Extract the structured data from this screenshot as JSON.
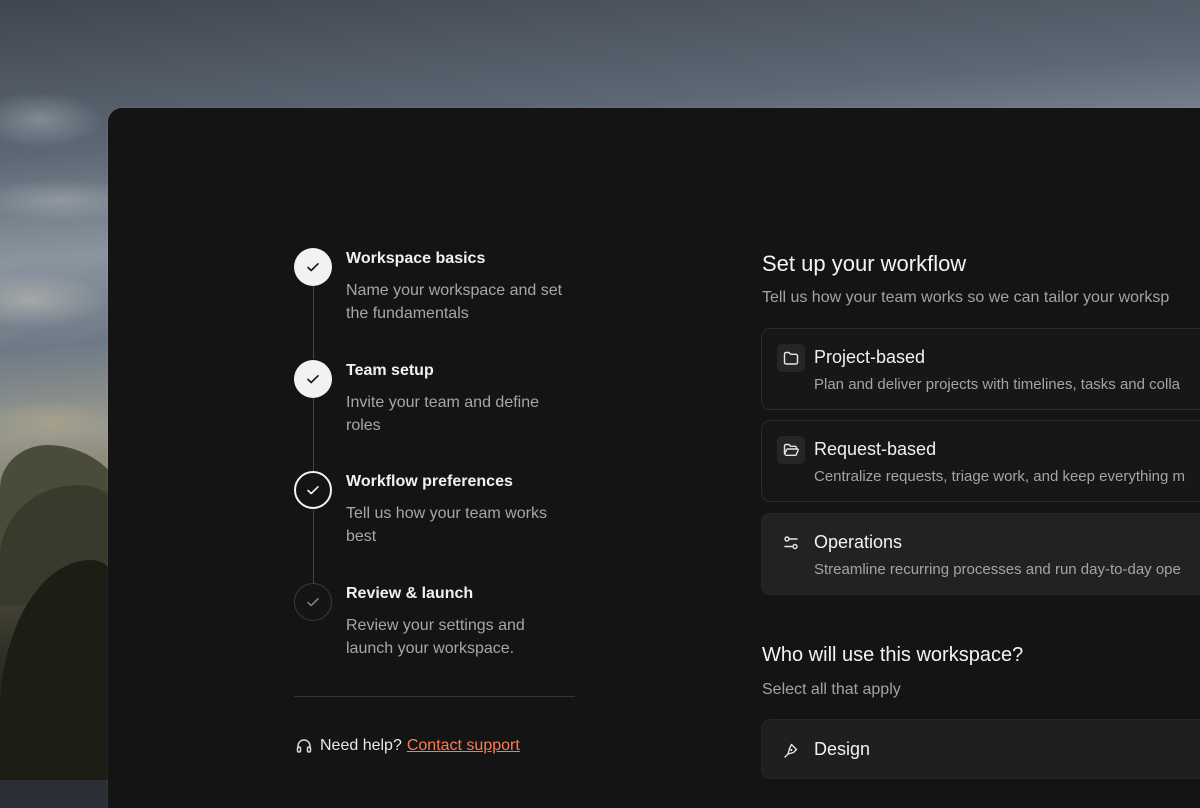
{
  "colors": {
    "panel": "#141414",
    "accent_link": "#ff7a52",
    "step_done": "#f2f2f2"
  },
  "stepper": {
    "steps": [
      {
        "title": "Workspace basics",
        "description": "Name your workspace and set the fundamentals",
        "state": "completed",
        "icon": "check-icon"
      },
      {
        "title": "Team setup",
        "description": "Invite your team and define roles",
        "state": "completed",
        "icon": "check-icon"
      },
      {
        "title": "Workflow preferences",
        "description": "Tell us how your team works best",
        "state": "current",
        "icon": "check-icon"
      },
      {
        "title": "Review & launch",
        "description": "Review your settings and launch your workspace.",
        "state": "upcoming",
        "icon": "check-icon"
      }
    ]
  },
  "help": {
    "icon": "headset-icon",
    "label": "Need help?",
    "link": "Contact support"
  },
  "workflow": {
    "title": "Set up your workflow",
    "subtitle": "Tell us how your team works so we can tailor your worksp",
    "options": [
      {
        "title": "Project-based",
        "description": "Plan and deliver projects with timelines, tasks and colla",
        "icon": "folder-icon"
      },
      {
        "title": "Request-based",
        "description": "Centralize requests, triage work, and keep everything m",
        "icon": "folder-open-icon"
      },
      {
        "title": "Operations",
        "description": "Streamline recurring processes and run day-to-day ope",
        "icon": "sliders-icon",
        "selected": true
      }
    ]
  },
  "audience": {
    "title": "Who will use this workspace?",
    "subtitle": "Select all that apply",
    "options": [
      {
        "title": "Design",
        "icon": "pen-tool-icon"
      }
    ]
  }
}
